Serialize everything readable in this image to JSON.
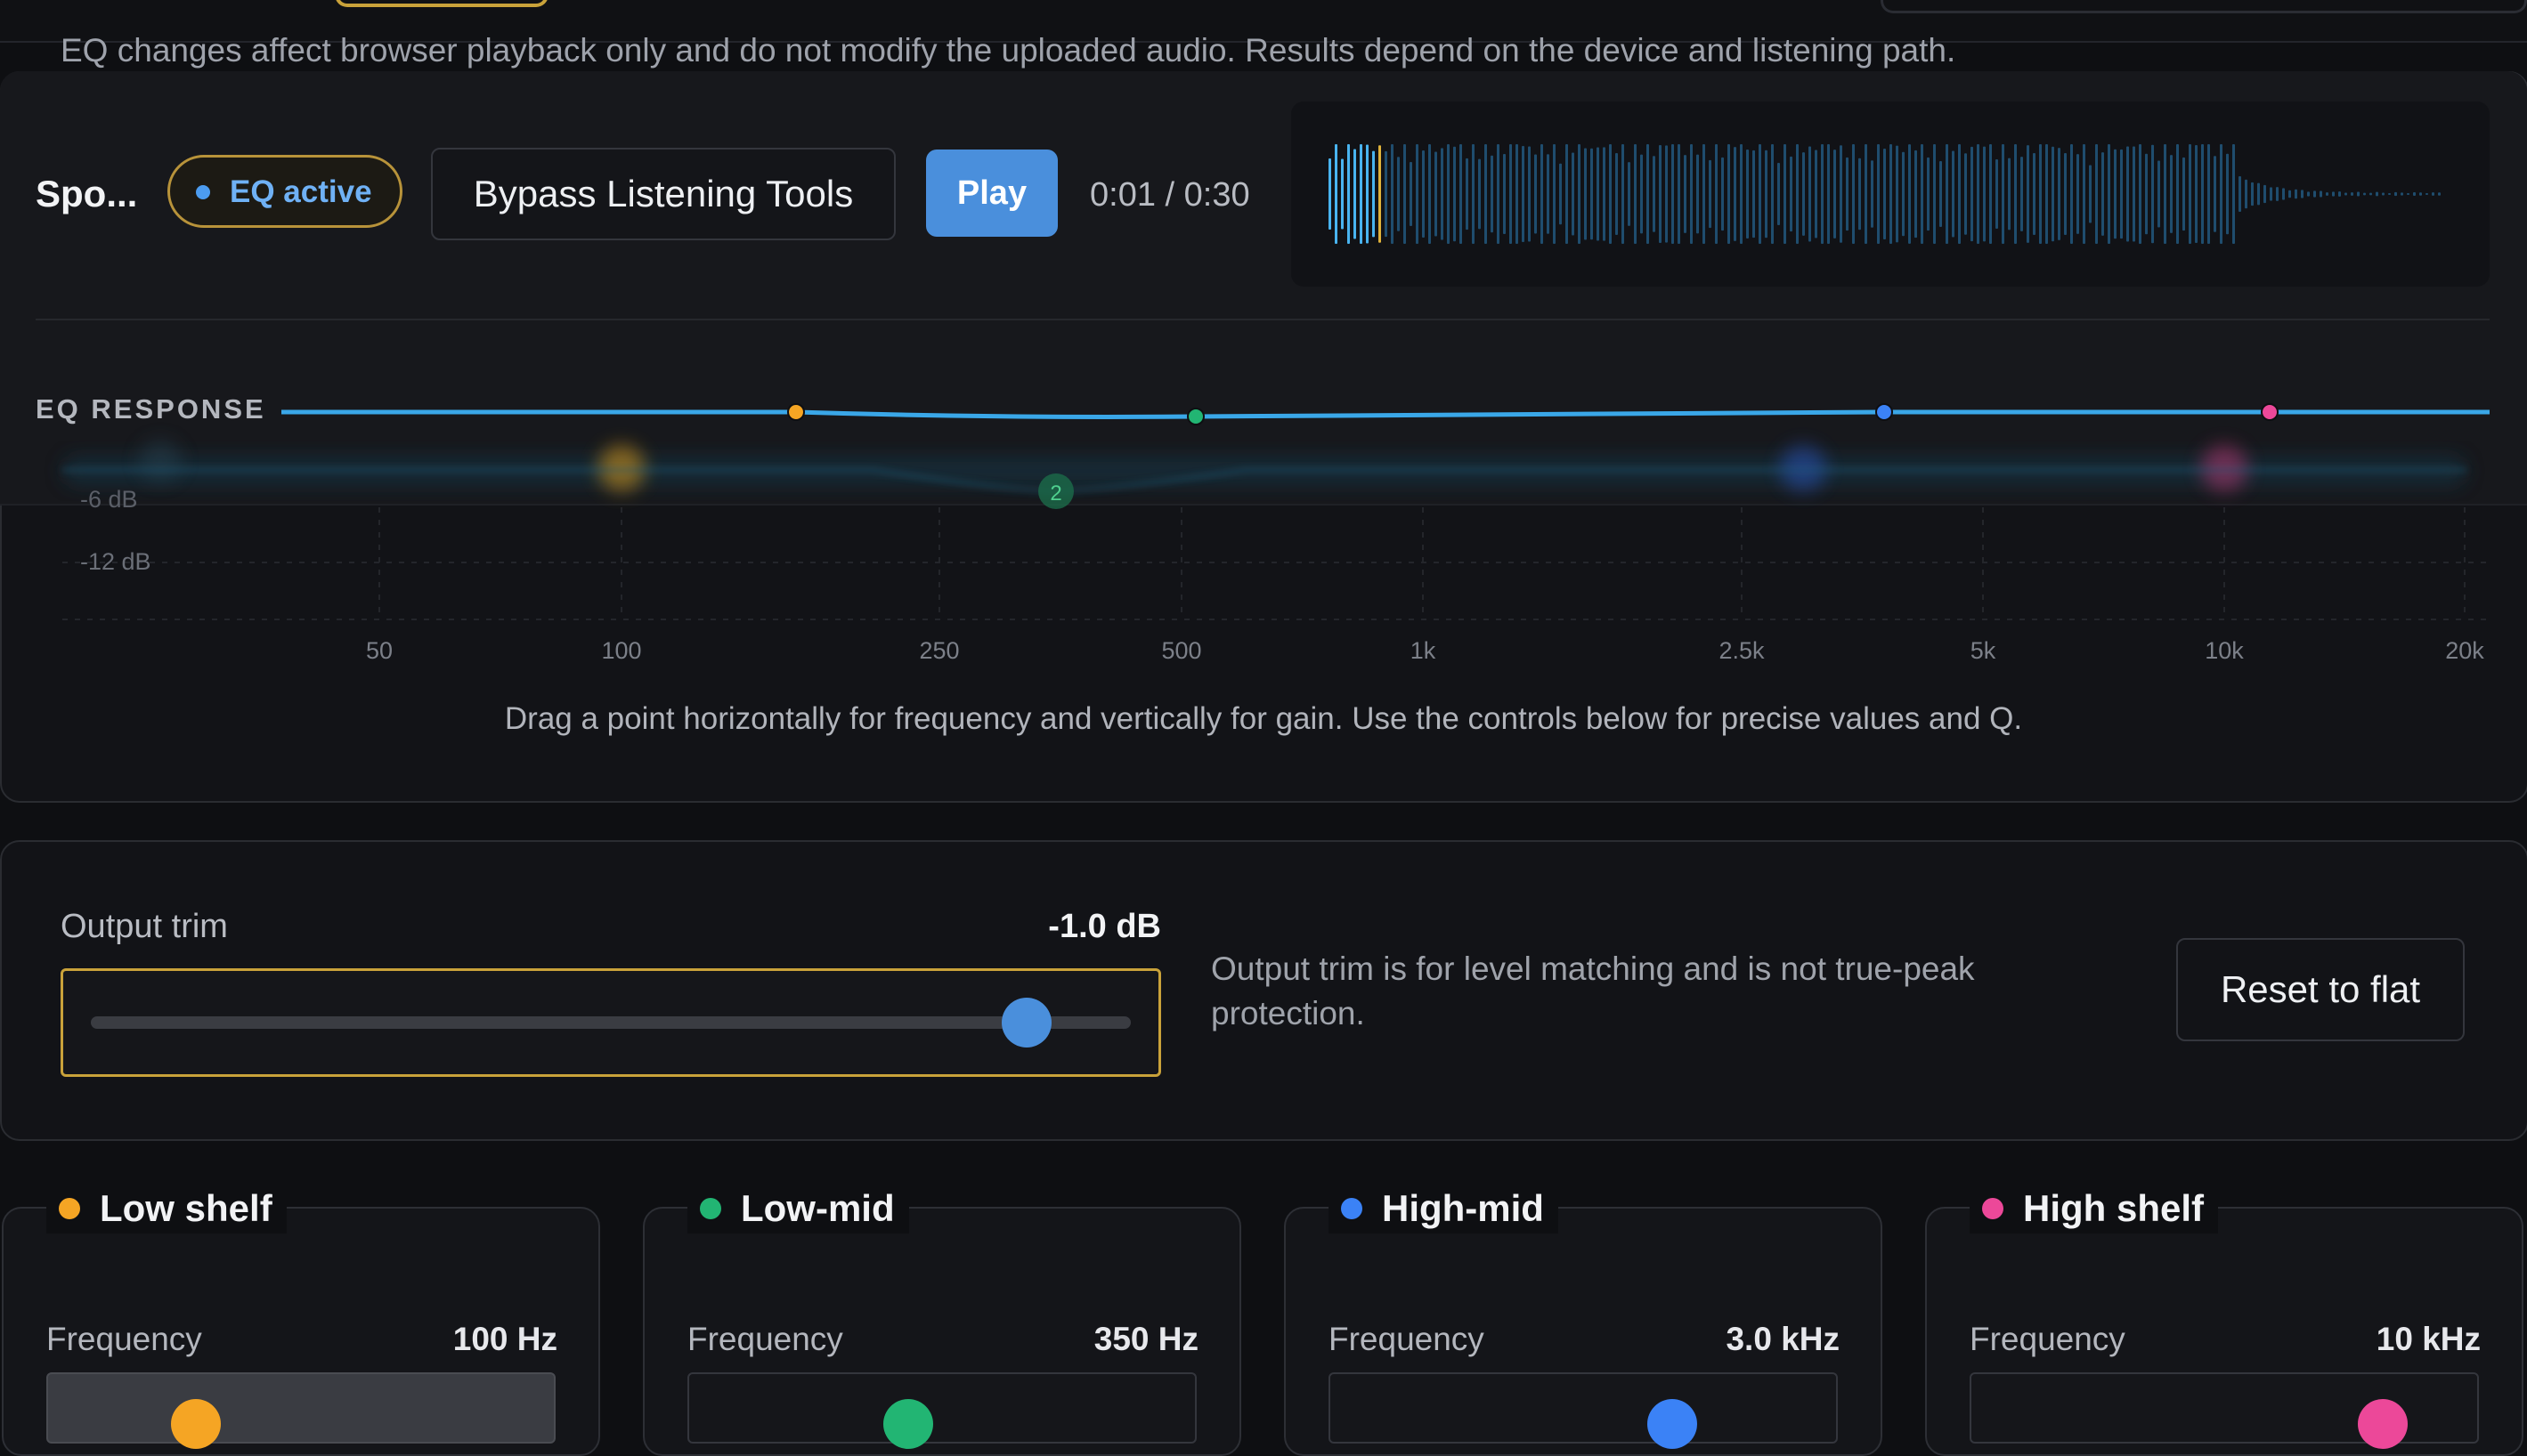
{
  "disclaimer": "EQ changes affect browser playback only and do not modify the uploaded audio. Results depend on the device and listening path.",
  "player": {
    "track_name": "Spo...",
    "eq_badge": "EQ active",
    "bypass_label": "Bypass Listening Tools",
    "play_label": "Play",
    "time": "0:01 / 0:30"
  },
  "eq_response": {
    "label": "EQ RESPONSE",
    "db_ticks": [
      "-6 dB",
      "-12 dB"
    ],
    "freq_ticks": [
      "50",
      "100",
      "250",
      "500",
      "1k",
      "2.5k",
      "5k",
      "10k",
      "20k"
    ],
    "handle_label": "2",
    "hint": "Drag a point horizontally for frequency and vertically for gain. Use the controls below for precise values and Q."
  },
  "trim": {
    "label": "Output trim",
    "value": "-1.0 dB",
    "level_fraction": 0.9,
    "note": "Output trim is for level matching and is not true-peak protection.",
    "reset_label": "Reset to flat"
  },
  "bands": [
    {
      "name": "Low shelf",
      "color": "#f5a524",
      "freq_label": "Frequency",
      "freq_value": "100 Hz"
    },
    {
      "name": "Low-mid",
      "color": "#22b573",
      "freq_label": "Frequency",
      "freq_value": "350 Hz"
    },
    {
      "name": "High-mid",
      "color": "#3b82f6",
      "freq_label": "Frequency",
      "freq_value": "3.0 kHz"
    },
    {
      "name": "High shelf",
      "color": "#ec4899",
      "freq_label": "Frequency",
      "freq_value": "10 kHz"
    }
  ],
  "colors": {
    "accent": "#4a8fdc",
    "curve": "#3aa7e8",
    "focus": "#c9a23a"
  }
}
